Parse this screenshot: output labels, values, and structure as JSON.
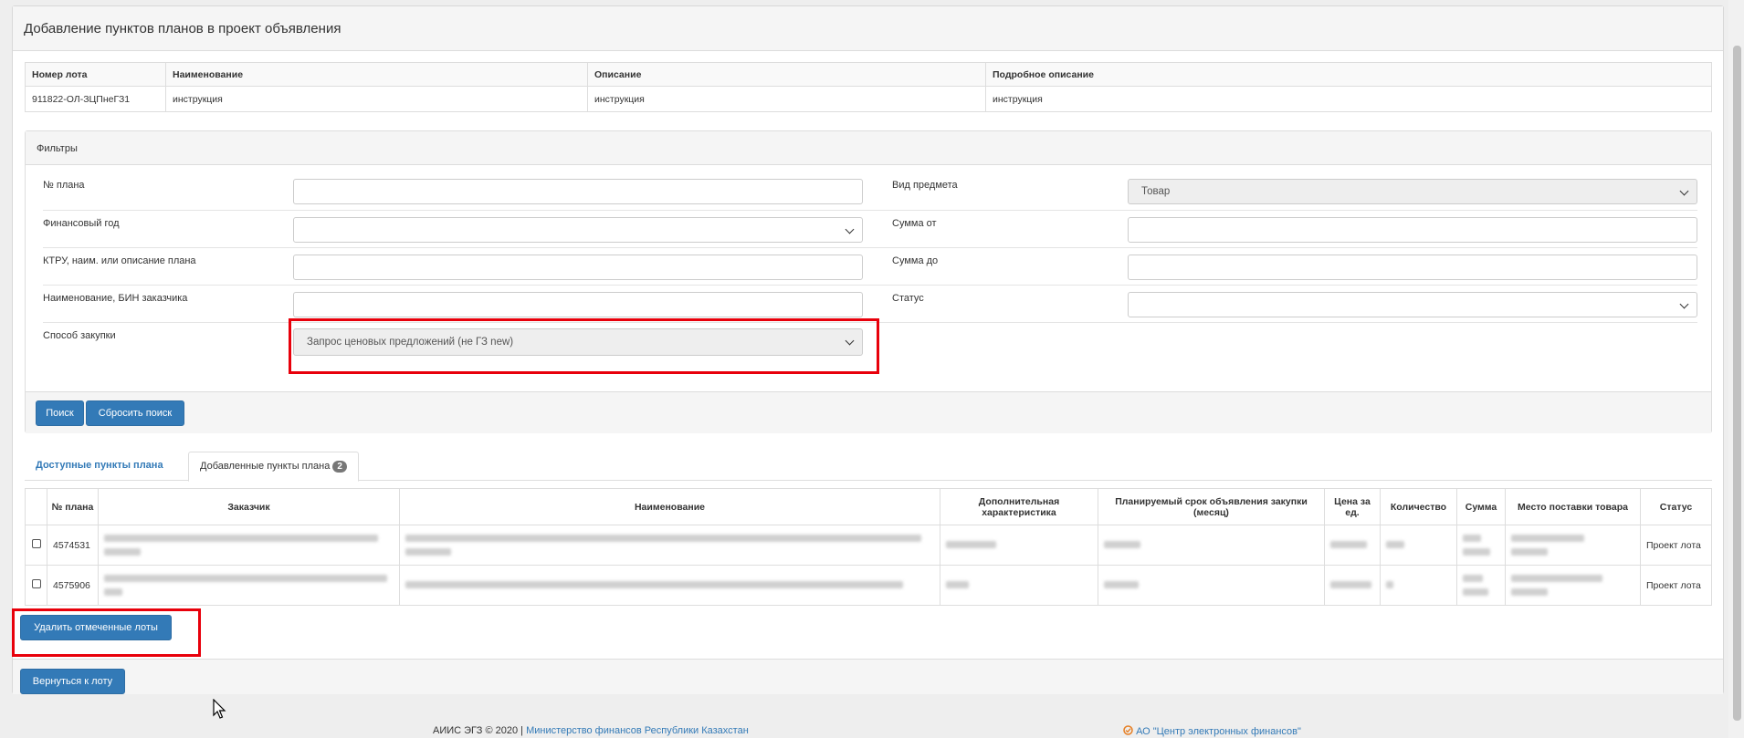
{
  "panel": {
    "title": "Добавление пунктов планов в проект объявления"
  },
  "lot_table": {
    "headers": [
      "Номер лота",
      "Наименование",
      "Описание",
      "Подробное описание"
    ],
    "row": [
      "911822-ОЛ-ЗЦПнеГЗ1",
      "инструкция",
      "инструкция",
      "инструкция"
    ]
  },
  "filters": {
    "title": "Фильтры",
    "plan_no_label": "№ плана",
    "subject_type_label": "Вид предмета",
    "subject_type_value": "Товар",
    "fin_year_label": "Финансовый год",
    "sum_from_label": "Сумма от",
    "ktru_label": "КТРУ, наим. или описание плана",
    "sum_to_label": "Сумма до",
    "customer_label": "Наименование, БИН заказчика",
    "status_label": "Статус",
    "method_label": "Способ закупки",
    "method_value": "Запрос ценовых предложений (не ГЗ new)",
    "search_button": "Поиск",
    "reset_button": "Сбросить поиск"
  },
  "tabs": {
    "available": "Доступные пункты плана",
    "added": "Добавленные пункты плана",
    "added_count": "2"
  },
  "items_table": {
    "headers": {
      "plan_no": "№ плана",
      "customer": "Заказчик",
      "name": "Наименование",
      "extra": "Дополнительная характеристика",
      "term": "Планируемый срок объявления закупки (месяц)",
      "price": "Цена за ед.",
      "qty": "Количество",
      "sum": "Сумма",
      "place": "Место поставки товара",
      "status": "Статус"
    },
    "rows": [
      {
        "plan_no": "4574531",
        "status": "Проект лота"
      },
      {
        "plan_no": "4575906",
        "status": "Проект лота"
      }
    ]
  },
  "delete_button": "Удалить отмеченные лоты",
  "back_button": "Вернуться к лоту",
  "footer": {
    "copyright": "АИИС ЭГЗ © 2020 | ",
    "ministry_link": "Министерство финансов Республики Казахстан",
    "center_link": "АО \"Центр электронных финансов\""
  },
  "colors": {
    "primary": "#337ab7",
    "highlight": "#e8000b"
  }
}
